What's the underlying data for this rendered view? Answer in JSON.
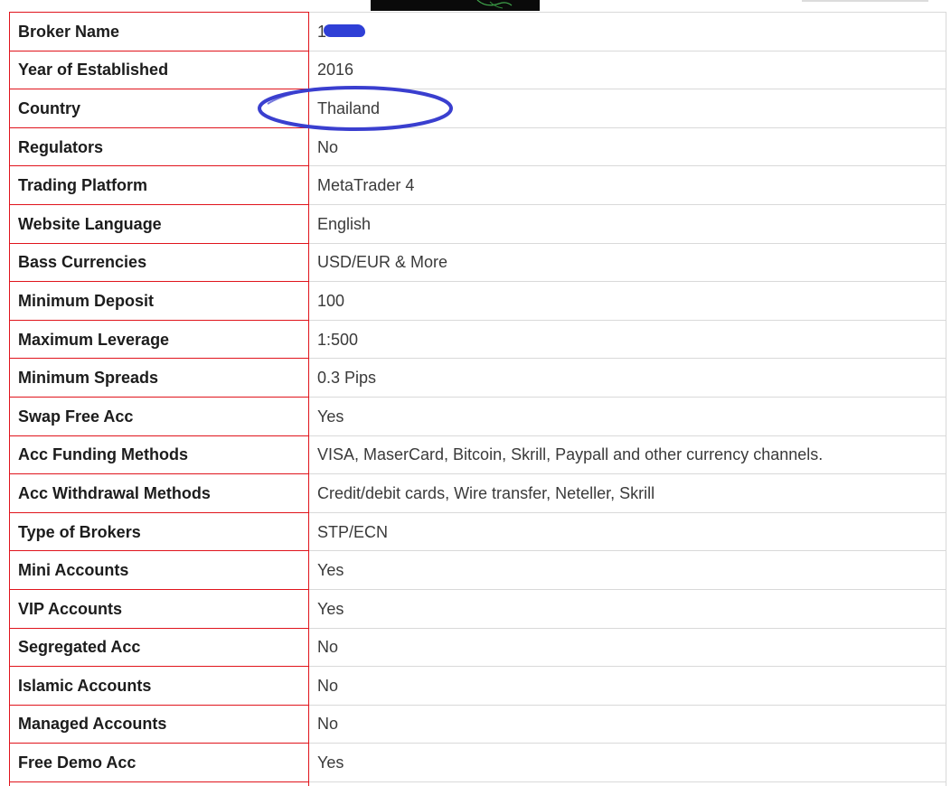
{
  "colors": {
    "label_border": "#e0141c",
    "value_border": "#d9d9d9",
    "annotation": "#3a3fcf",
    "redaction": "#2f3fd6"
  },
  "broker_specs": {
    "rows": [
      {
        "label": "Broker Name",
        "value": "1"
      },
      {
        "label": "Year of Established",
        "value": "2016"
      },
      {
        "label": "Country",
        "value": "Thailand"
      },
      {
        "label": "Regulators",
        "value": "No"
      },
      {
        "label": "Trading Platform",
        "value": "MetaTrader 4"
      },
      {
        "label": "Website Language",
        "value": "English"
      },
      {
        "label": "Bass Currencies",
        "value": "USD/EUR & More"
      },
      {
        "label": "Minimum Deposit",
        "value": "100"
      },
      {
        "label": "Maximum Leverage",
        "value": "1:500"
      },
      {
        "label": "Minimum Spreads",
        "value": "0.3 Pips"
      },
      {
        "label": "Swap Free Acc",
        "value": "Yes"
      },
      {
        "label": "Acc Funding Methods",
        "value": "VISA, MaserCard, Bitcoin, Skrill, Paypall and other currency channels."
      },
      {
        "label": "Acc Withdrawal Methods",
        "value": "Credit/debit cards, Wire transfer, Neteller, Skrill"
      },
      {
        "label": "Type of Brokers",
        "value": "STP/ECN"
      },
      {
        "label": "Mini Accounts",
        "value": "Yes"
      },
      {
        "label": "VIP Accounts",
        "value": "Yes"
      },
      {
        "label": "Segregated Acc",
        "value": "No"
      },
      {
        "label": "Islamic Accounts",
        "value": "No"
      },
      {
        "label": "Managed Accounts",
        "value": "No"
      },
      {
        "label": "Free Demo Acc",
        "value": "Yes"
      },
      {
        "label": "",
        "value": ""
      }
    ]
  }
}
